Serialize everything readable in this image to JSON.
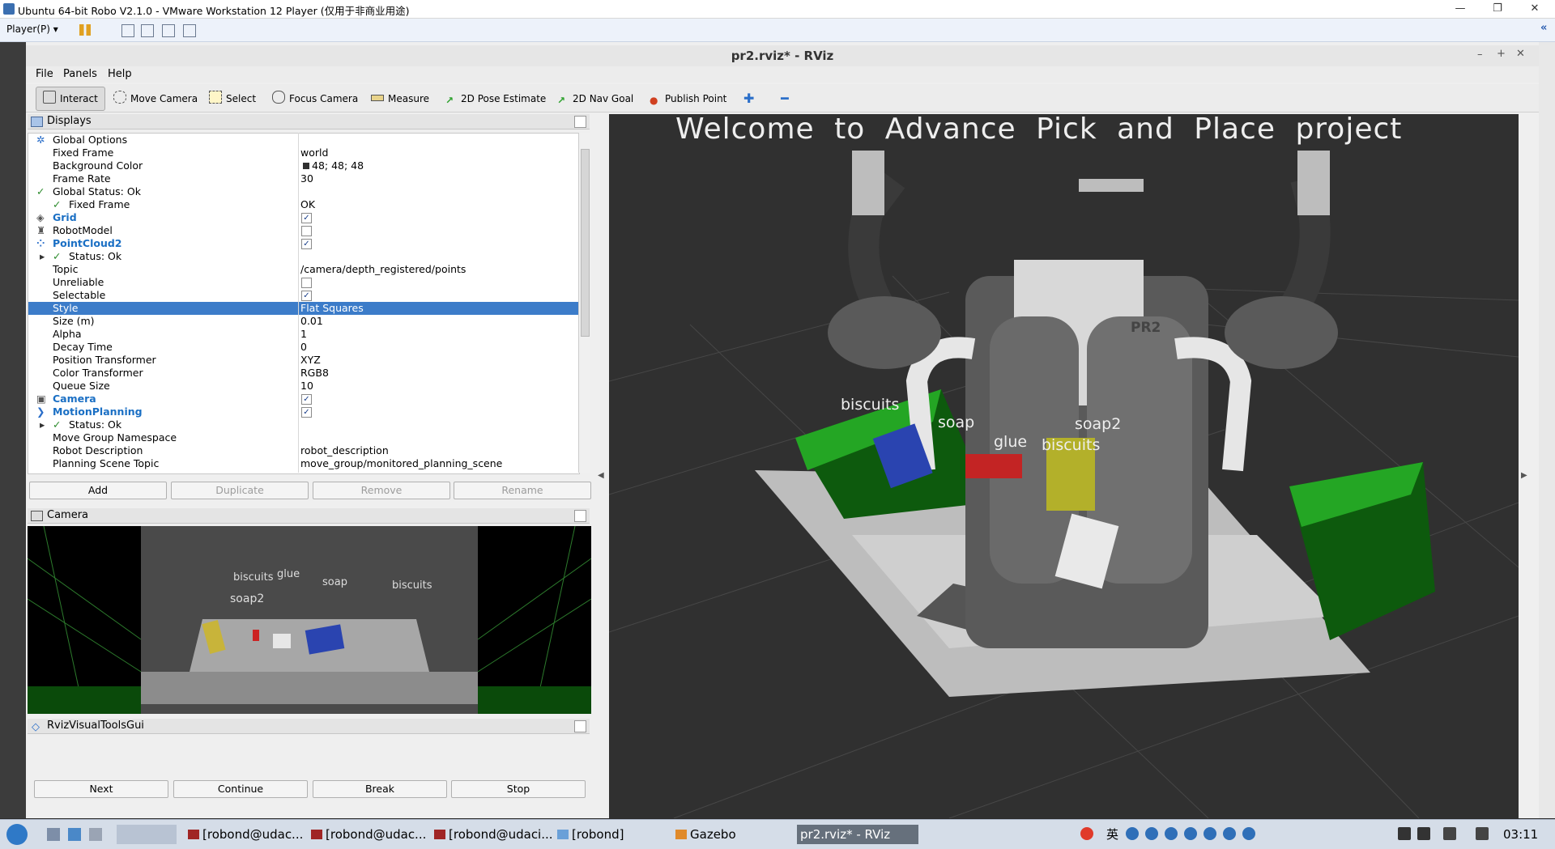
{
  "vm": {
    "title": "Ubuntu 64-bit Robo V2.1.0 - VMware Workstation 12 Player (仅用于非商业用途)",
    "player_menu": "Player(P)",
    "controls": {
      "minimize": "—",
      "restore": "❐",
      "close": "✕"
    }
  },
  "rviz": {
    "title": "pr2.rviz* - RViz",
    "menus": [
      "File",
      "Panels",
      "Help"
    ],
    "tools": [
      "Interact",
      "Move Camera",
      "Select",
      "Focus Camera",
      "Measure",
      "2D Pose Estimate",
      "2D Nav Goal",
      "Publish Point"
    ],
    "active_tool": "Interact",
    "displays": {
      "title": "Displays",
      "rows": [
        {
          "label": "Global Options",
          "value": ""
        },
        {
          "label": "Fixed Frame",
          "value": "world"
        },
        {
          "label": "Background Color",
          "value": "48; 48; 48"
        },
        {
          "label": "Frame Rate",
          "value": "30"
        },
        {
          "label": "Global Status: Ok",
          "value": ""
        },
        {
          "label": "Fixed Frame",
          "value": "OK"
        },
        {
          "label": "Grid",
          "value": ""
        },
        {
          "label": "RobotModel",
          "value": ""
        },
        {
          "label": "PointCloud2",
          "value": ""
        },
        {
          "label": "Status: Ok",
          "value": ""
        },
        {
          "label": "Topic",
          "value": "/camera/depth_registered/points"
        },
        {
          "label": "Unreliable",
          "value": ""
        },
        {
          "label": "Selectable",
          "value": ""
        },
        {
          "label": "Style",
          "value": "Flat Squares"
        },
        {
          "label": "Size (m)",
          "value": "0.01"
        },
        {
          "label": "Alpha",
          "value": "1"
        },
        {
          "label": "Decay Time",
          "value": "0"
        },
        {
          "label": "Position Transformer",
          "value": "XYZ"
        },
        {
          "label": "Color Transformer",
          "value": "RGB8"
        },
        {
          "label": "Queue Size",
          "value": "10"
        },
        {
          "label": "Camera",
          "value": ""
        },
        {
          "label": "MotionPlanning",
          "value": ""
        },
        {
          "label": "Status: Ok",
          "value": ""
        },
        {
          "label": "Move Group Namespace",
          "value": ""
        },
        {
          "label": "Robot Description",
          "value": "robot_description"
        },
        {
          "label": "Planning Scene Topic",
          "value": "move_group/monitored_planning_scene"
        }
      ],
      "buttons": [
        "Add",
        "Duplicate",
        "Remove",
        "Rename"
      ]
    },
    "camera": {
      "title": "Camera",
      "labels": [
        "biscuits",
        "glue",
        "soap",
        "biscuits",
        "soap2"
      ]
    },
    "rvt": {
      "title": "RvizVisualToolsGui",
      "buttons": [
        "Next",
        "Continue",
        "Break",
        "Stop"
      ]
    },
    "view3d": {
      "banner": "Welcome to Advance Pick and Place project",
      "labels": [
        "biscuits",
        "soap",
        "glue",
        "soap2",
        "biscuits"
      ],
      "robot_label": "PR2"
    }
  },
  "taskbar": {
    "items": [
      "[robond@udac...",
      "[robond@udac...",
      "[robond@udaci...",
      "[robond]",
      "Gazebo",
      "pr2.rviz* - RViz"
    ],
    "ime": "英",
    "clock": "03:11"
  },
  "colors": {
    "selection": "#3c7cc9",
    "bin_green": "#22a322",
    "background_3d": "#303030"
  }
}
